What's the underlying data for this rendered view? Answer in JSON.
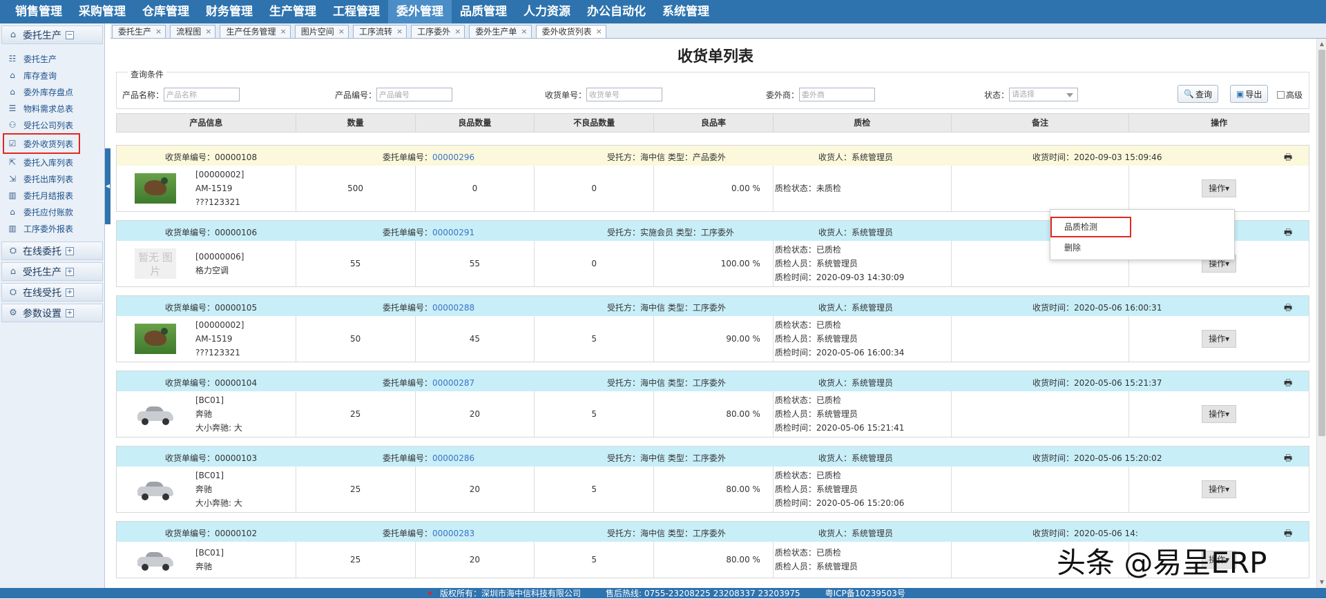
{
  "topnav": [
    "销售管理",
    "采购管理",
    "仓库管理",
    "财务管理",
    "生产管理",
    "工程管理",
    "委外管理",
    "品质管理",
    "人力资源",
    "办公自动化",
    "系统管理"
  ],
  "sidebar": {
    "groups": [
      {
        "label": "委托生产",
        "toggle": "−",
        "items": [
          "委托生产",
          "库存查询",
          "委外库存盘点",
          "物料需求总表",
          "受托公司列表",
          "委外收货列表",
          "委托入库列表",
          "委托出库列表",
          "委托月结报表",
          "委托应付账款",
          "工序委外报表"
        ]
      },
      {
        "label": "在线委托",
        "toggle": "+"
      },
      {
        "label": "受托生产",
        "toggle": "+"
      },
      {
        "label": "在线受托",
        "toggle": "+"
      },
      {
        "label": "参数设置",
        "toggle": "+"
      }
    ]
  },
  "tabs": [
    "委托生产",
    "流程图",
    "生产任务管理",
    "图片空间",
    "工序流转",
    "工序委外",
    "委外生产单",
    "委外收货列表"
  ],
  "page": {
    "title": "收货单列表"
  },
  "query": {
    "legend": "查询条件",
    "fields": [
      {
        "label": "产品名称：",
        "placeholder": "产品名称"
      },
      {
        "label": "产品编号：",
        "placeholder": "产品编号"
      },
      {
        "label": "收货单号：",
        "placeholder": "收货单号"
      },
      {
        "label": "委外商：",
        "placeholder": "委外商"
      }
    ],
    "status_label": "状态：",
    "status_placeholder": "请选择",
    "search_btn": "查询",
    "export_btn": "导出",
    "advanced": "高级"
  },
  "table": {
    "headers": [
      "产品信息",
      "数量",
      "良品数量",
      "不良品数量",
      "良品率",
      "质检",
      "备注",
      "操作"
    ],
    "op_label": "操作▾",
    "records": [
      {
        "no": "收货单编号：00000108",
        "order_prefix": "委托单编号：",
        "order": "00000296",
        "party": "受托方：海中信 类型：产品委外",
        "receiver": "收货人：系统管理员",
        "time": "收货时间：2020-09-03 15:09:46",
        "thumb": "bird",
        "thumb_text": "",
        "info": [
          "[00000002]",
          "AM-1519",
          "???123321"
        ],
        "qty": "500",
        "good": "0",
        "bad": "0",
        "rate": "0.00 %",
        "qc": [
          "质检状态：未质检"
        ]
      },
      {
        "no": "收货单编号：00000106",
        "order_prefix": "委托单编号：",
        "order": "00000291",
        "party": "受托方：实施会员 类型：工序委外",
        "receiver": "收货人：系统管理员",
        "time": "",
        "thumb": "none",
        "thumb_text": "暂无 图片",
        "info": [
          "[00000006]",
          "格力空调"
        ],
        "qty": "55",
        "good": "55",
        "bad": "0",
        "rate": "100.00 %",
        "qc": [
          "质检状态：已质检",
          "质检人员：系统管理员",
          "质检时间：2020-09-03 14:30:09"
        ]
      },
      {
        "no": "收货单编号：00000105",
        "order_prefix": "委托单编号：",
        "order": "00000288",
        "party": "受托方：海中信 类型：工序委外",
        "receiver": "收货人：系统管理员",
        "time": "收货时间：2020-05-06 16:00:31",
        "thumb": "bird",
        "thumb_text": "",
        "info": [
          "[00000002]",
          "AM-1519",
          "???123321"
        ],
        "qty": "50",
        "good": "45",
        "bad": "5",
        "rate": "90.00 %",
        "qc": [
          "质检状态：已质检",
          "质检人员：系统管理员",
          "质检时间：2020-05-06 16:00:34"
        ]
      },
      {
        "no": "收货单编号：00000104",
        "order_prefix": "委托单编号：",
        "order": "00000287",
        "party": "受托方：海中信 类型：工序委外",
        "receiver": "收货人：系统管理员",
        "time": "收货时间：2020-05-06 15:21:37",
        "thumb": "car",
        "thumb_text": "",
        "info": [
          "[BC01]",
          "奔驰",
          "大小奔驰: 大"
        ],
        "qty": "25",
        "good": "20",
        "bad": "5",
        "rate": "80.00 %",
        "qc": [
          "质检状态：已质检",
          "质检人员：系统管理员",
          "质检时间：2020-05-06 15:21:41"
        ]
      },
      {
        "no": "收货单编号：00000103",
        "order_prefix": "委托单编号：",
        "order": "00000286",
        "party": "受托方：海中信 类型：工序委外",
        "receiver": "收货人：系统管理员",
        "time": "收货时间：2020-05-06 15:20:02",
        "thumb": "car",
        "thumb_text": "",
        "info": [
          "[BC01]",
          "奔驰",
          "大小奔驰: 大"
        ],
        "qty": "25",
        "good": "20",
        "bad": "5",
        "rate": "80.00 %",
        "qc": [
          "质检状态：已质检",
          "质检人员：系统管理员",
          "质检时间：2020-05-06 15:20:06"
        ]
      },
      {
        "no": "收货单编号：00000102",
        "order_prefix": "委托单编号：",
        "order": "00000283",
        "party": "受托方：海中信 类型：工序委外",
        "receiver": "收货人：系统管理员",
        "time": "收货时间：2020-05-06 14:",
        "thumb": "car",
        "thumb_text": "",
        "info": [
          "[BC01]",
          "奔驰"
        ],
        "qty": "25",
        "good": "20",
        "bad": "5",
        "rate": "80.00 %",
        "qc": [
          "质检状态：已质检",
          "质检人员：系统管理员"
        ]
      }
    ]
  },
  "dropdown": {
    "items": [
      "品质检测",
      "删除"
    ]
  },
  "footer": {
    "copyright": "版权所有：深圳市海中信科技有限公司",
    "hotline": "售后热线: 0755-23208225 23208337 23203975",
    "icp": "粤ICP备10239503号"
  },
  "watermark": "头条 @易呈ERP",
  "colors": {
    "nav_bg": "#2e73ae",
    "link": "#3b73c5",
    "highlight_border": "#e0281e",
    "row_head_yellow": "#fbf8dc",
    "row_head_blue": "#c8eef8"
  }
}
